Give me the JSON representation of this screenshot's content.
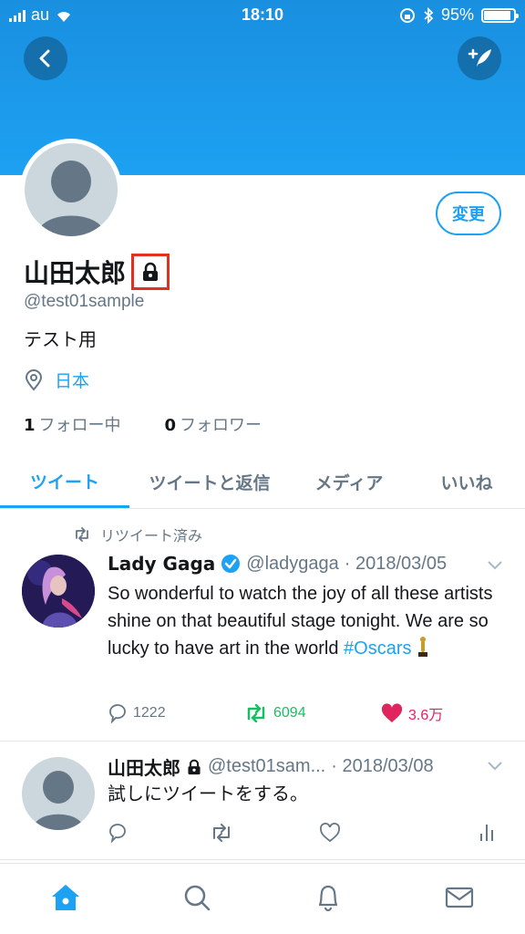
{
  "status_bar": {
    "carrier": "au",
    "time": "18:10",
    "battery": "95%"
  },
  "profile": {
    "edit_label": "変更",
    "name": "山田太郎",
    "handle": "@test01sample",
    "bio": "テスト用",
    "location": "日本",
    "following_count": "1",
    "following_label": "フォロー中",
    "followers_count": "0",
    "followers_label": "フォロワー"
  },
  "tabs": [
    {
      "label": "ツイート",
      "active": true
    },
    {
      "label": "ツイートと返信",
      "active": false
    },
    {
      "label": "メディア",
      "active": false
    },
    {
      "label": "いいね",
      "active": false
    }
  ],
  "tweets": [
    {
      "retweet_label": "リツイート済み",
      "author": "Lady Gaga",
      "handle": "@ladygaga",
      "date": "· 2018/03/05",
      "text": "So wonderful to watch the joy of all these artists shine on that beautiful stage tonight. We are so lucky to have art in the world ",
      "hashtag": "#Oscars",
      "replies": "1222",
      "retweets": "6094",
      "likes": "3.6万"
    },
    {
      "author": "山田太郎",
      "handle": "@test01sam...",
      "date": "· 2018/03/08",
      "text": "試しにツイートをする。"
    }
  ],
  "colors": {
    "accent": "#1da1f2",
    "retweet": "#17bf63",
    "like": "#e0245e",
    "highlight": "#e0301e"
  },
  "icons": [
    "back-icon",
    "compose-icon",
    "lock-icon",
    "location-pin-icon",
    "retweet-icon",
    "verified-icon",
    "chevron-down-icon",
    "reply-icon",
    "like-icon",
    "analytics-icon",
    "home-icon",
    "search-icon",
    "notifications-icon",
    "messages-icon"
  ]
}
